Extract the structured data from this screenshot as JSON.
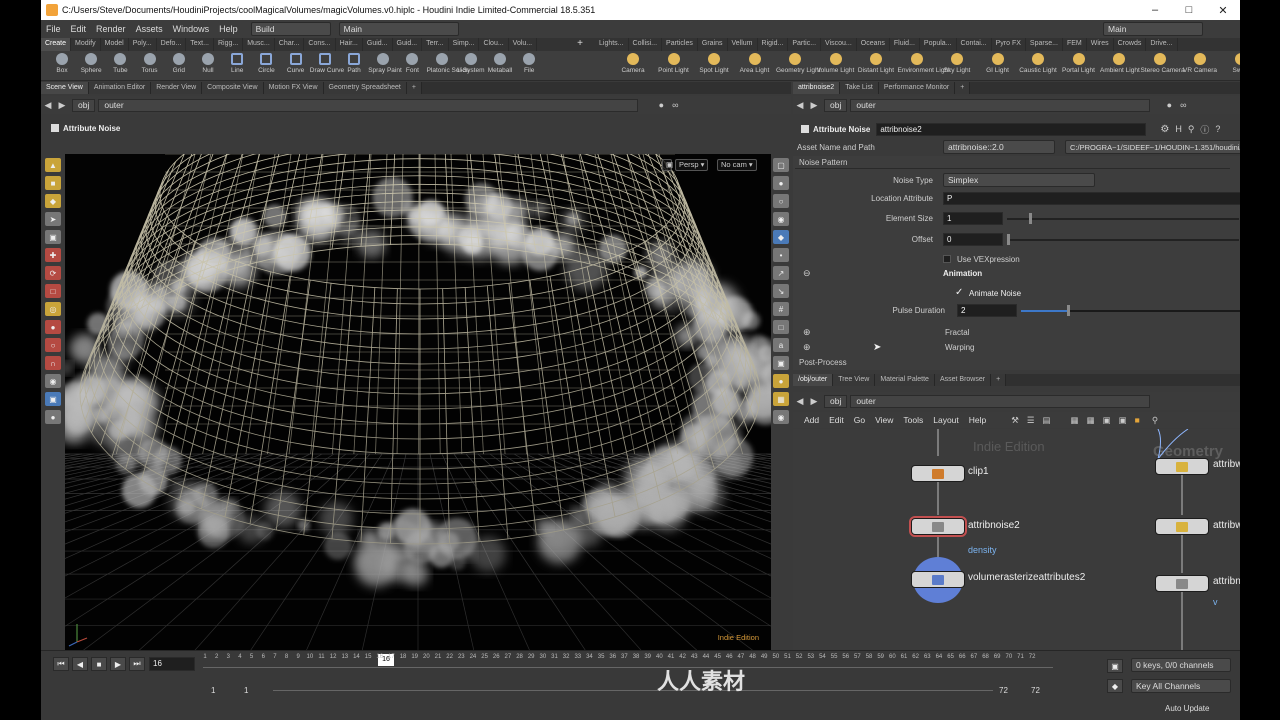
{
  "window": {
    "title": "C:/Users/Steve/Documents/HoudiniProjects/coolMagicalVolumes/magicVolumes.v0.hiplc - Houdini Indie Limited-Commercial 18.5.351"
  },
  "menu": {
    "items": [
      "File",
      "Edit",
      "Render",
      "Assets",
      "Windows",
      "Help"
    ],
    "build": "Build",
    "main": "Main",
    "desktop": "Main"
  },
  "shelf_tabs_left": [
    "Create",
    "Modify",
    "Model",
    "Poly...",
    "Defo...",
    "Text...",
    "Rigg...",
    "Musc...",
    "Char...",
    "Cons...",
    "Hair...",
    "Guid...",
    "Guid...",
    "Terr...",
    "Simp...",
    "Clou...",
    "Volu..."
  ],
  "shelf_tabs_right": [
    "Lights...",
    "Collisi...",
    "Particles",
    "Grains",
    "Vellum",
    "Rigid...",
    "Partic...",
    "Viscou...",
    "Oceans",
    "Fluid...",
    "Popula...",
    "Contai...",
    "Pyro FX",
    "Sparse...",
    "FEM",
    "Wires",
    "Crowds",
    "Drive..."
  ],
  "tools_left": [
    "Box",
    "Sphere",
    "Tube",
    "Torus",
    "Grid",
    "Null",
    "Line",
    "Circle",
    "Curve",
    "Draw Curve",
    "Path",
    "Spray Paint",
    "Font",
    "Platonic Solids",
    "L-System",
    "Metaball",
    "File"
  ],
  "tools_right": [
    "Camera",
    "Point Light",
    "Spot Light",
    "Area Light",
    "Geometry Light",
    "Volume Light",
    "Distant Light",
    "Environment Light",
    "Sky Light",
    "GI Light",
    "Caustic Light",
    "Portal Light",
    "Ambient Light",
    "Stereo Camera",
    "VR Camera",
    "Swi..."
  ],
  "left_pane": {
    "tabs": [
      "Scene View",
      "Animation Editor",
      "Render View",
      "Composite View",
      "Motion FX View",
      "Geometry Spreadsheet"
    ],
    "path": [
      "obj",
      "outer"
    ],
    "viewport_title": "Attribute Noise",
    "persp": "Persp",
    "cam": "No cam",
    "indie": "Indie Edition"
  },
  "parm_pane": {
    "tabs": [
      "attribnoise2",
      "Take List",
      "Performance Monitor"
    ],
    "path": [
      "obj",
      "outer"
    ],
    "node_type": "Attribute Noise",
    "node_name": "attribnoise2",
    "asset_label": "Asset Name and Path",
    "asset_name": "attribnoise::2.0",
    "asset_path": "C:/PROGRA~1/SIDEEF~1/HOUDIN~1.351/houdini/o...",
    "section_noise": "Noise Pattern",
    "noise_type_label": "Noise Type",
    "noise_type": "Simplex",
    "location_label": "Location Attribute",
    "location": "P",
    "element_size_label": "Element Size",
    "element_size": "1",
    "offset_label": "Offset",
    "offset": "0",
    "use_vex": "Use VEXpression",
    "animation": "Animation",
    "animate_noise": "Animate Noise",
    "pulse_label": "Pulse Duration",
    "pulse": "2",
    "fractal": "Fractal",
    "warping": "Warping",
    "post_process": "Post-Process"
  },
  "network_pane": {
    "tabs": [
      "/obj/outer",
      "Tree View",
      "Material Palette",
      "Asset Browser"
    ],
    "path": [
      "obj",
      "outer"
    ],
    "menu": [
      "Add",
      "Edit",
      "Go",
      "View",
      "Tools",
      "Layout",
      "Help"
    ],
    "watermark": "Indie Edition",
    "context": "Geometry",
    "nodes": [
      {
        "name": "clip1",
        "sub": ""
      },
      {
        "name": "attribnoise2",
        "sub": "density"
      },
      {
        "name": "volumerasterizeattributes2",
        "sub": ""
      },
      {
        "name": "attribwrangle3",
        "sub": ""
      },
      {
        "name": "attribwrangle4",
        "sub": ""
      },
      {
        "name": "attribnoise1",
        "sub": "v"
      }
    ]
  },
  "timeline": {
    "frame": "16",
    "current": "16",
    "start": "1",
    "start2": "1",
    "end": "72",
    "end2": "72",
    "ticks": [
      "1",
      "2",
      "3",
      "4",
      "5",
      "6",
      "7",
      "8",
      "9",
      "10",
      "11",
      "12",
      "13",
      "14",
      "15",
      "16",
      "17",
      "18",
      "19",
      "20",
      "21",
      "22",
      "23",
      "24",
      "25",
      "26",
      "27",
      "28",
      "29",
      "30",
      "31",
      "32",
      "33",
      "34",
      "35",
      "36",
      "37",
      "38",
      "39",
      "40",
      "41",
      "42",
      "43",
      "44",
      "45",
      "46",
      "47",
      "48",
      "49",
      "50",
      "51",
      "52",
      "53",
      "54",
      "55",
      "56",
      "57",
      "58",
      "59",
      "60",
      "61",
      "62",
      "63",
      "64",
      "65",
      "66",
      "67",
      "68",
      "69",
      "70",
      "71",
      "72"
    ],
    "keys": "0 keys, 0/0 channels",
    "key_all": "Key All Channels",
    "auto_update": "Auto Update"
  },
  "overlay": {
    "logo_text": "人人素材"
  }
}
